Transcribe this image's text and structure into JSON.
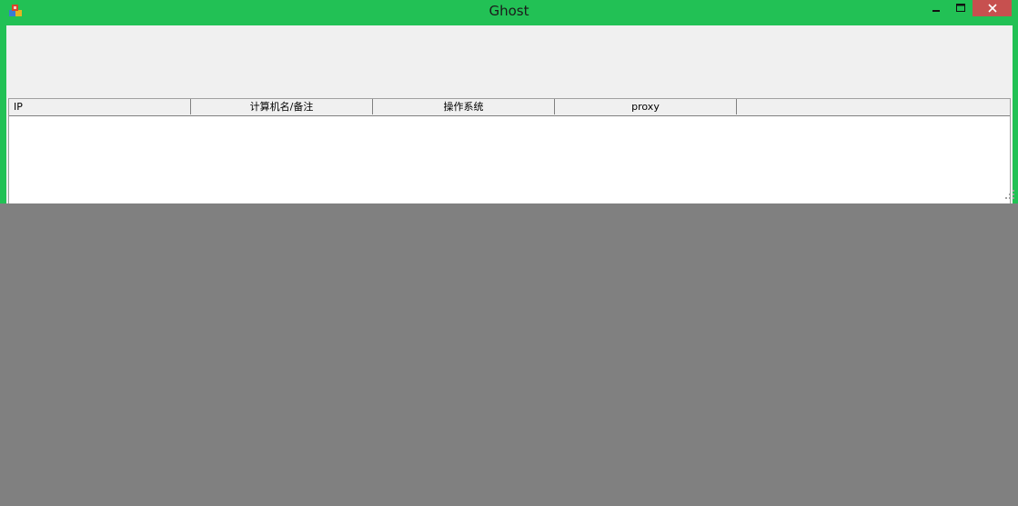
{
  "window": {
    "title": "Ghost",
    "app_icon": "app-icon",
    "controls": {
      "minimize": "–",
      "maximize": "□",
      "close": "✕"
    }
  },
  "listview": {
    "columns": [
      {
        "label": "IP"
      },
      {
        "label": "计算机名/备注"
      },
      {
        "label": "操作系统"
      },
      {
        "label": "proxy"
      },
      {
        "label": ""
      }
    ],
    "rows": []
  },
  "colors": {
    "title_bar": "#22c155",
    "close_button": "#c7504f",
    "client_background": "#f0f0f0",
    "desktop": "#808080"
  }
}
